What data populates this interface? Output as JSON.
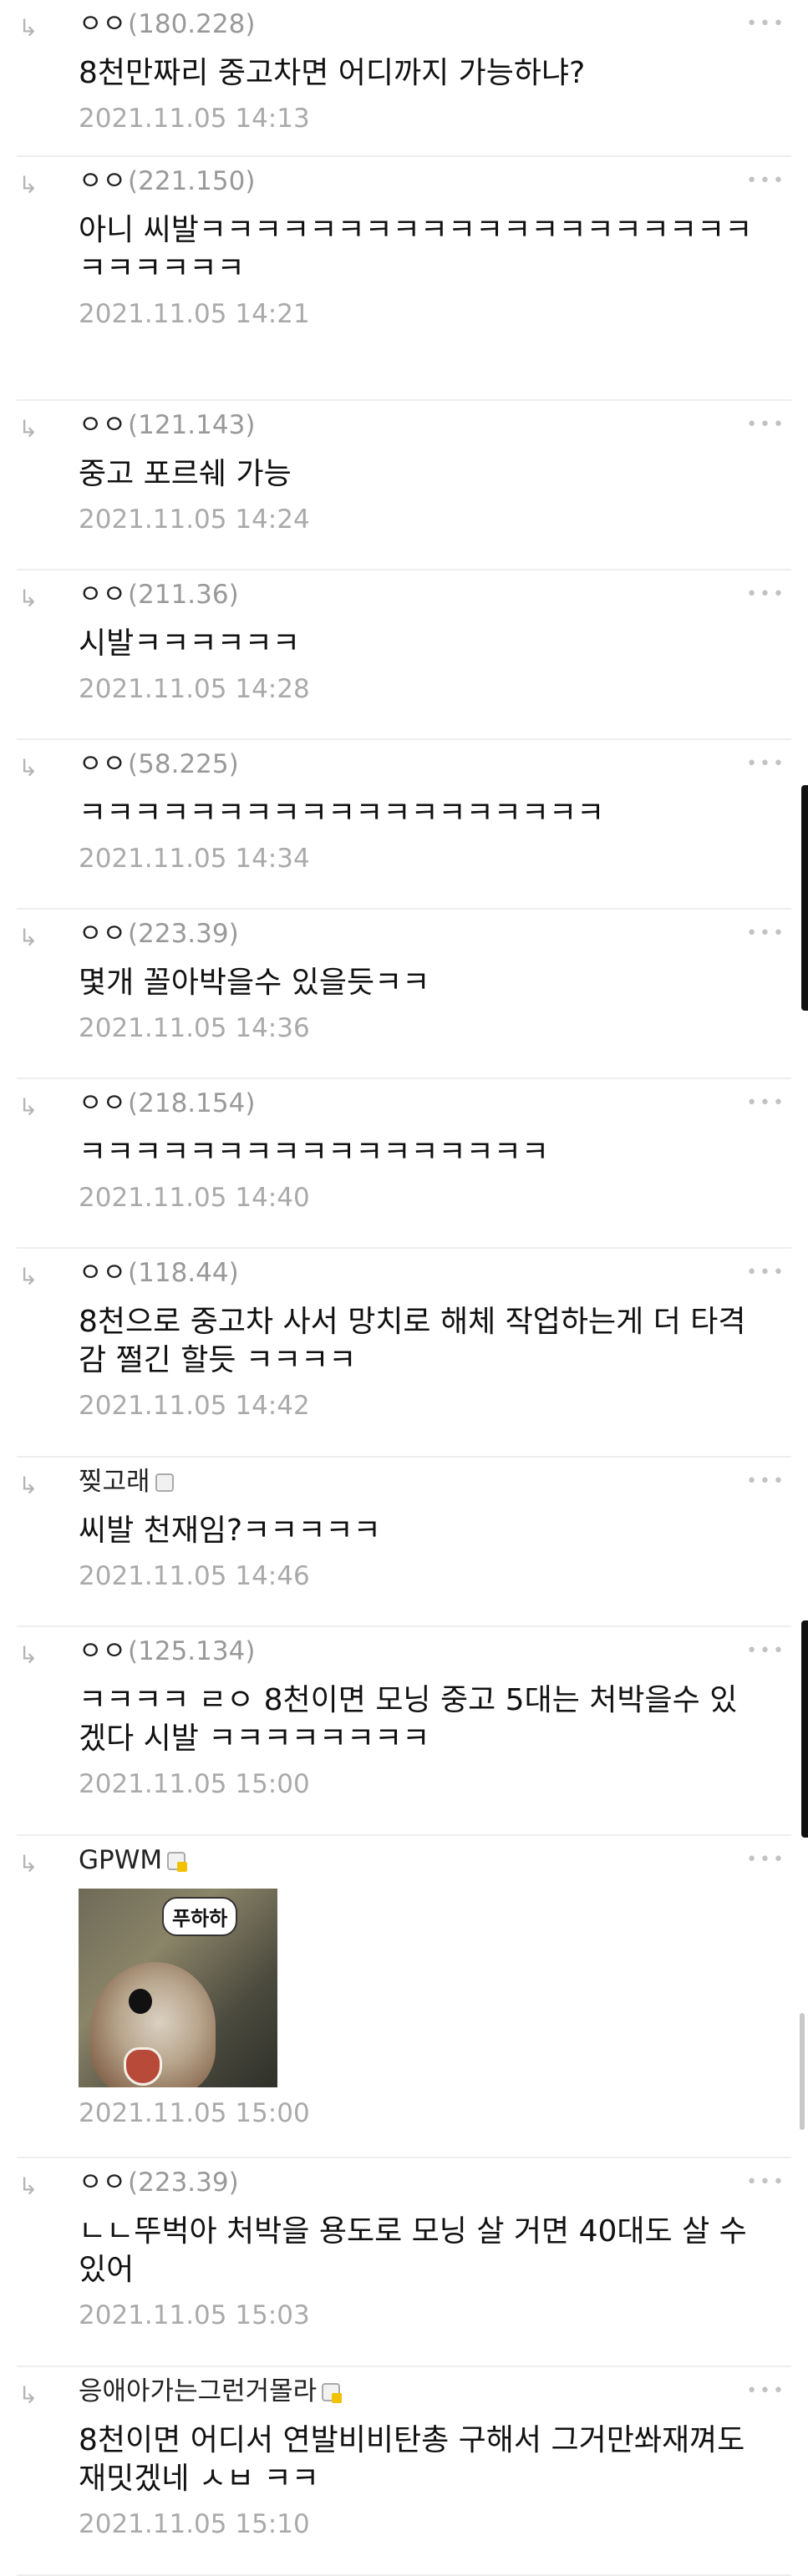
{
  "comments": [
    {
      "writer": "ㅇㅇ",
      "ip": "(180.228)",
      "text": "8천만짜리 중고차면 어디까지 가능하냐?",
      "date": "2021.11.05 14:13"
    },
    {
      "writer": "ㅇㅇ",
      "ip": "(221.150)",
      "text": "아니 씨발ㅋㅋㅋㅋㅋㅋㅋㅋㅋㅋㅋㅋㅋㅋㅋㅋㅋㅋㅋㅋㅋㅋㅋㅋㅋㅋ",
      "date": "2021.11.05 14:21"
    },
    {
      "writer": "ㅇㅇ",
      "ip": "(121.143)",
      "text": "중고 포르쉐 가능",
      "date": "2021.11.05 14:24"
    },
    {
      "writer": "ㅇㅇ",
      "ip": "(211.36)",
      "text": "시발ㅋㅋㅋㅋㅋㅋ",
      "date": "2021.11.05 14:28"
    },
    {
      "writer": "ㅇㅇ",
      "ip": "(58.225)",
      "text": "ㅋㅋㅋㅋㅋㅋㅋㅋㅋㅋㅋㅋㅋㅋㅋㅋㅋㅋㅋ",
      "date": "2021.11.05 14:34"
    },
    {
      "writer": "ㅇㅇ",
      "ip": "(223.39)",
      "text": "몇개 꼴아박을수 있을듯ㅋㅋ",
      "date": "2021.11.05 14:36"
    },
    {
      "writer": "ㅇㅇ",
      "ip": "(218.154)",
      "text": "ㅋㅋㅋㅋㅋㅋㅋㅋㅋㅋㅋㅋㅋㅋㅋㅋㅋ",
      "date": "2021.11.05 14:40"
    },
    {
      "writer": "ㅇㅇ",
      "ip": "(118.44)",
      "text": "8천으로 중고차 사서 망치로 해체 작업하는게 더 타격감 쩔긴 할듯 ㅋㅋㅋㅋ",
      "date": "2021.11.05 14:42"
    },
    {
      "writer": "찢고래",
      "ip": "",
      "badge": "plain",
      "text": "씨발 천재임?ㅋㅋㅋㅋㅋ",
      "date": "2021.11.05 14:46"
    },
    {
      "writer": "ㅇㅇ",
      "ip": "(125.134)",
      "text": "ㅋㅋㅋㅋ ㄹㅇ 8천이면 모닝 중고 5대는 처박을수 있겠다 시발 ㅋㅋㅋㅋㅋㅋㅋㅋ",
      "date": "2021.11.05 15:00"
    },
    {
      "writer": "GPWM",
      "ip": "",
      "badge": "gold",
      "dccon": "푸하하",
      "text": "",
      "date": "2021.11.05 15:00"
    },
    {
      "writer": "ㅇㅇ",
      "ip": "(223.39)",
      "text": "ㄴㄴ뚜벅아 처박을 용도로 모닝 살 거면 40대도 살 수 있어",
      "date": "2021.11.05 15:03"
    },
    {
      "writer": "응애아가는그런거몰라",
      "ip": "",
      "badge": "gold",
      "text": "8천이면 어디서 연발비비탄총 구해서 그거만쏴재껴도 재밋겠네 ㅅㅂ ㅋㅋ",
      "date": "2021.11.05 15:10"
    }
  ],
  "ui": {
    "reply_arrow": "↳",
    "more_dots": "•••"
  }
}
